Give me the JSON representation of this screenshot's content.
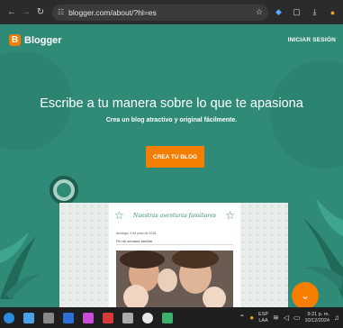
{
  "browser": {
    "back": "←",
    "forward": "→",
    "reload": "↻",
    "url": "blogger.com/about/?hl=es"
  },
  "header": {
    "logo_letter": "B",
    "logo_text": "Blogger",
    "signin_label": "INICIAR SESIÓN"
  },
  "hero": {
    "title": "Escribe a tu manera sobre lo que te apasiona",
    "subtitle": "Crea un blog atractivo y original fácilmente.",
    "cta_label": "CREA TU BLOG"
  },
  "preview": {
    "blog_title": "Nuestras aventuras familiares",
    "date": "domingo, 3 de junio de 2018",
    "post_title": "Fin de semana familiar"
  },
  "fab": {
    "icon": "chevron-down-icon"
  },
  "taskbar": {
    "lang_line1": "ESP",
    "lang_line2": "LAA",
    "time": "9:21 p. m.",
    "date": "10/12/2024"
  },
  "colors": {
    "page_bg": "#2f8a77",
    "accent": "#f57d00"
  }
}
